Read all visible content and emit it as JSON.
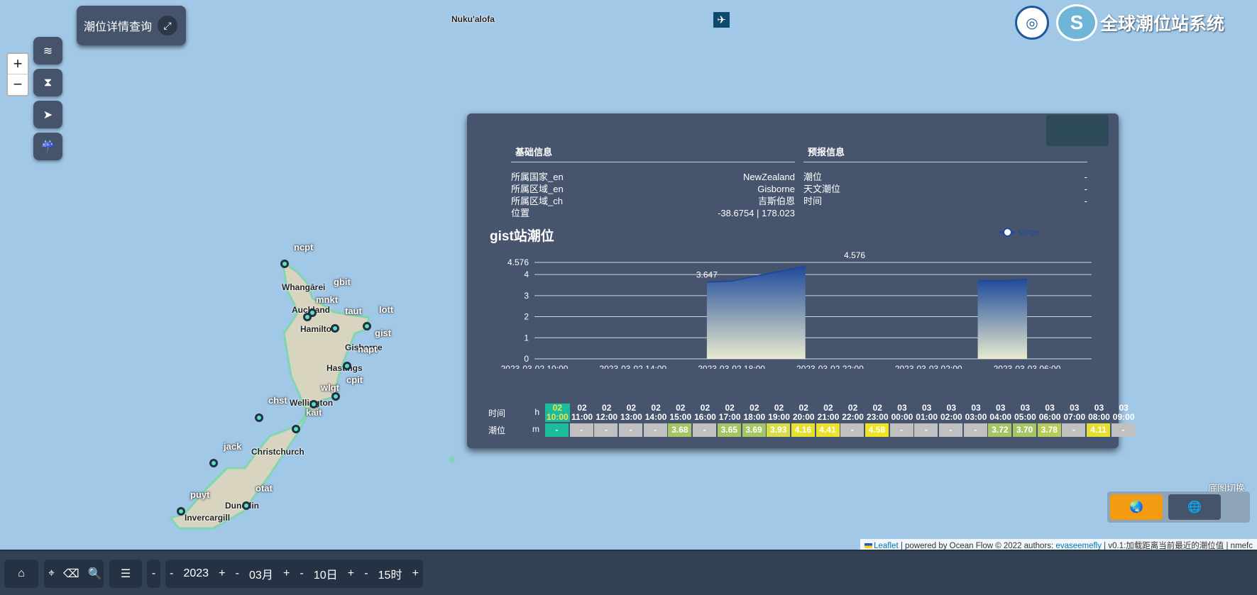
{
  "map": {
    "place_labels": [
      {
        "name": "place-nukualofa",
        "text": "Nuku'alofa"
      },
      {
        "name": "place-whangarei",
        "text": "Whangārei"
      },
      {
        "name": "place-auckland",
        "text": "Auckland"
      },
      {
        "name": "place-hamilton",
        "text": "Hamilton"
      },
      {
        "name": "place-gisborne",
        "text": "Gisborne"
      },
      {
        "name": "place-hastings",
        "text": "Hastings"
      },
      {
        "name": "place-wellington",
        "text": "Wellington"
      },
      {
        "name": "place-christchurch",
        "text": "Christchurch"
      },
      {
        "name": "place-dunedin",
        "text": "Dunedin"
      },
      {
        "name": "place-invercargill",
        "text": "Invercargill"
      }
    ],
    "stations": [
      "ncpt",
      "gbit",
      "mnkt",
      "taut",
      "lott",
      "gist",
      "napt",
      "cpit",
      "wlgt",
      "chst",
      "kait",
      "jack",
      "otat",
      "puyt"
    ]
  },
  "zoom": {
    "in": "+",
    "out": "−"
  },
  "query_box": {
    "label": "潮位详情查询",
    "expand_icon": "expand-icon"
  },
  "sidebar_icons": [
    "waves-icon",
    "hourglass-icon",
    "navigation-icon",
    "storm-surge-icon"
  ],
  "logo": {
    "title": "全球潮位站系统"
  },
  "panel": {
    "basic_info": {
      "heading": "基础信息",
      "rows": [
        {
          "label": "所属国家_en",
          "value": "NewZealand"
        },
        {
          "label": "所属区域_en",
          "value": "Gisborne"
        },
        {
          "label": "所属区域_ch",
          "value": "吉斯伯恩"
        },
        {
          "label": "位置",
          "value": "-38.6754 | 178.023"
        }
      ]
    },
    "forecast_info": {
      "heading": "预报信息",
      "rows": [
        {
          "label": "潮位",
          "value": "-"
        },
        {
          "label": "天文潮位",
          "value": "-"
        },
        {
          "label": "时间",
          "value": "-"
        }
      ]
    }
  },
  "chart_data": {
    "type": "area",
    "title": "gist站潮位",
    "legend": [
      {
        "name": "surge",
        "color": "#1e4a9a"
      }
    ],
    "legend_position": "top-right",
    "grid": true,
    "ylim": [
      0,
      4.576
    ],
    "yticks": [
      0,
      1,
      2,
      3,
      4,
      4.576
    ],
    "x_tick_labels": [
      "2023-03-02 10:00",
      "2023-03-02 14:00",
      "2023-03-02 18:00",
      "2023-03-02 22:00",
      "2023-03-03 02:00",
      "2023-03-03 06:00"
    ],
    "series": [
      {
        "name": "surge",
        "color": "#1e4a9a",
        "points": [
          {
            "x": "2023-03-02 17:00",
            "y": 3.647
          },
          {
            "x": "2023-03-02 18:00",
            "y": 3.69
          },
          {
            "x": "2023-03-02 19:00",
            "y": 3.93
          },
          {
            "x": "2023-03-02 20:00",
            "y": 4.16
          },
          {
            "x": "2023-03-02 21:00",
            "y": 4.41
          },
          {
            "x": "2023-03-03 04:00",
            "y": 3.72
          },
          {
            "x": "2023-03-03 05:00",
            "y": 3.7
          },
          {
            "x": "2023-03-03 06:00",
            "y": 3.78
          }
        ]
      }
    ],
    "annotations": [
      {
        "text": "3.647",
        "x": "2023-03-02 17:00",
        "y": 3.647
      },
      {
        "text": "4.576",
        "x": "2023-03-02 23:00",
        "y": 4.576
      }
    ]
  },
  "tide_table": {
    "time_label": "时间",
    "time_unit": "h",
    "level_label": "潮位",
    "level_unit": "m",
    "hours": [
      {
        "day": "02",
        "hour": "10:00",
        "value": "-",
        "color": "#1abc9c"
      },
      {
        "day": "02",
        "hour": "11:00",
        "value": "-",
        "color": "#c0c0c0"
      },
      {
        "day": "02",
        "hour": "12:00",
        "value": "-",
        "color": "#c0c0c0"
      },
      {
        "day": "02",
        "hour": "13:00",
        "value": "-",
        "color": "#c0c0c0"
      },
      {
        "day": "02",
        "hour": "14:00",
        "value": "-",
        "color": "#c0c0c0"
      },
      {
        "day": "02",
        "hour": "15:00",
        "value": "3.68",
        "color": "#a6c565"
      },
      {
        "day": "02",
        "hour": "16:00",
        "value": "-",
        "color": "#c0c0c0"
      },
      {
        "day": "02",
        "hour": "17:00",
        "value": "3.65",
        "color": "#a6c565"
      },
      {
        "day": "02",
        "hour": "18:00",
        "value": "3.69",
        "color": "#a6c565"
      },
      {
        "day": "02",
        "hour": "19:00",
        "value": "3.93",
        "color": "#d9dd48"
      },
      {
        "day": "02",
        "hour": "20:00",
        "value": "4.16",
        "color": "#e8e030"
      },
      {
        "day": "02",
        "hour": "21:00",
        "value": "4.41",
        "color": "#ece32a"
      },
      {
        "day": "02",
        "hour": "22:00",
        "value": "-",
        "color": "#c0c0c0"
      },
      {
        "day": "02",
        "hour": "23:00",
        "value": "4.58",
        "color": "#f0e426"
      },
      {
        "day": "03",
        "hour": "00:00",
        "value": "-",
        "color": "#c0c0c0"
      },
      {
        "day": "03",
        "hour": "01:00",
        "value": "-",
        "color": "#c0c0c0"
      },
      {
        "day": "03",
        "hour": "02:00",
        "value": "-",
        "color": "#c0c0c0"
      },
      {
        "day": "03",
        "hour": "03:00",
        "value": "-",
        "color": "#c0c0c0"
      },
      {
        "day": "03",
        "hour": "04:00",
        "value": "3.72",
        "color": "#a6c565"
      },
      {
        "day": "03",
        "hour": "05:00",
        "value": "3.70",
        "color": "#a6c565"
      },
      {
        "day": "03",
        "hour": "06:00",
        "value": "3.78",
        "color": "#b8cc5a"
      },
      {
        "day": "03",
        "hour": "07:00",
        "value": "-",
        "color": "#c0c0c0"
      },
      {
        "day": "03",
        "hour": "08:00",
        "value": "4.11",
        "color": "#e8e030"
      },
      {
        "day": "03",
        "hour": "09:00",
        "value": "-",
        "color": "#c0c0c0"
      }
    ]
  },
  "basemap": {
    "label": "底图切换",
    "options": [
      {
        "name": "basemap-terrain-button",
        "icon": "globe-color-icon",
        "active": true
      },
      {
        "name": "basemap-globe-button",
        "icon": "globe-icon",
        "active": false
      }
    ]
  },
  "attribution": {
    "leaflet": "Leaflet",
    "text1": " | powered by Ocean Flow © 2022 authors: ",
    "author": "evaseemefly",
    "text2": " | v0.1:加载距离当前最近的潮位值 | nmefc"
  },
  "bottom_bar": {
    "year": "2023",
    "month": "03月",
    "day": "10日",
    "hour": "15时",
    "minus": "-",
    "plus": "+"
  },
  "colors": {
    "panel_bg": "#46546e",
    "active_cell": "#1abc9c",
    "basemap_active": "#f39c12"
  }
}
